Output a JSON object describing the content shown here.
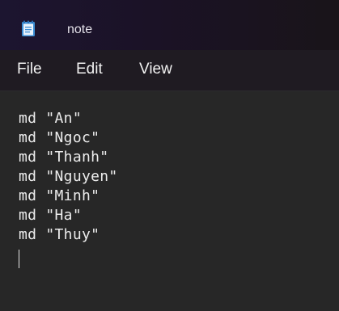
{
  "window": {
    "title": "note",
    "app_icon": "notepad-icon"
  },
  "menu": {
    "items": [
      {
        "label": "File"
      },
      {
        "label": "Edit"
      },
      {
        "label": "View"
      }
    ]
  },
  "editor": {
    "lines": [
      "md \"An\"",
      "md \"Ngoc\"",
      "md \"Thanh\"",
      "md \"Nguyen\"",
      "md \"Minh\"",
      "md \"Ha\"",
      "md \"Thuy\""
    ]
  },
  "colors": {
    "titlebar": "#1c1530",
    "menubar": "#1f1b22",
    "editor_background": "#272727",
    "text": "#ececec",
    "icon_blue": "#3c8fd6"
  }
}
